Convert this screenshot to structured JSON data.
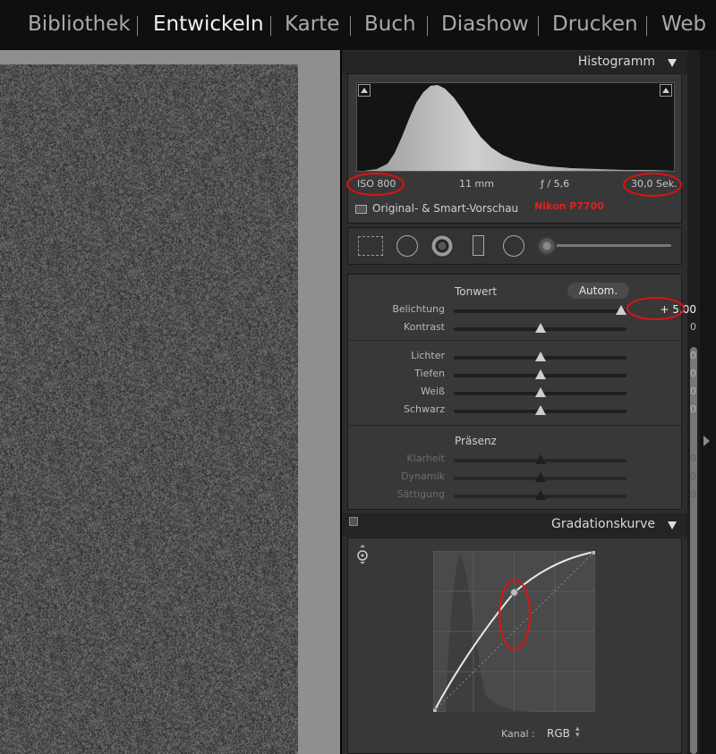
{
  "modules": [
    {
      "label": "Bibliothek",
      "active": false
    },
    {
      "label": "Entwickeln",
      "active": true
    },
    {
      "label": "Karte",
      "active": false
    },
    {
      "label": "Buch",
      "active": false
    },
    {
      "label": "Diashow",
      "active": false
    },
    {
      "label": "Drucken",
      "active": false
    },
    {
      "label": "Web",
      "active": false
    }
  ],
  "histogram": {
    "title": "Histogramm",
    "exif": {
      "iso": "ISO 800",
      "focal_length": "11 mm",
      "aperture": "ƒ / 5,6",
      "shutter": "30,0 Sek."
    },
    "preview_label": "Original- & Smart-Vorschau",
    "camera_annotation": "Nikon P7700"
  },
  "tools": [
    {
      "name": "crop-overlay-icon"
    },
    {
      "name": "spot-removal-icon"
    },
    {
      "name": "red-eye-icon"
    },
    {
      "name": "graduated-filter-icon"
    },
    {
      "name": "radial-filter-icon"
    },
    {
      "name": "adjustment-brush-icon"
    }
  ],
  "basic": {
    "tone_title": "Tonwert",
    "auto_label": "Autom.",
    "presence_title": "Präsenz",
    "tone_sliders": [
      {
        "label": "Belichtung",
        "value": "+ 5,00",
        "position": 1.0,
        "enabled": true
      },
      {
        "label": "Kontrast",
        "value": "0",
        "position": 0.5,
        "enabled": true
      }
    ],
    "light_sliders": [
      {
        "label": "Lichter",
        "value": "0",
        "position": 0.5,
        "enabled": true
      },
      {
        "label": "Tiefen",
        "value": "0",
        "position": 0.5,
        "enabled": true
      },
      {
        "label": "Weiß",
        "value": "0",
        "position": 0.5,
        "enabled": true
      },
      {
        "label": "Schwarz",
        "value": "0",
        "position": 0.5,
        "enabled": true
      }
    ],
    "presence_sliders": [
      {
        "label": "Klarheit",
        "value": "0",
        "position": 0.5,
        "enabled": false
      },
      {
        "label": "Dynamik",
        "value": "0",
        "position": 0.5,
        "enabled": false
      },
      {
        "label": "Sättigung",
        "value": "0",
        "position": 0.5,
        "enabled": false
      }
    ]
  },
  "tone_curve": {
    "title": "Gradationskurve",
    "channel_label": "Kanal :",
    "channel_value": "RGB",
    "points": [
      [
        0,
        0
      ],
      [
        0.5,
        0.745
      ],
      [
        1,
        1
      ]
    ]
  },
  "colors": {
    "annotation_red": "#e41010",
    "panel_bg": "#383838"
  }
}
